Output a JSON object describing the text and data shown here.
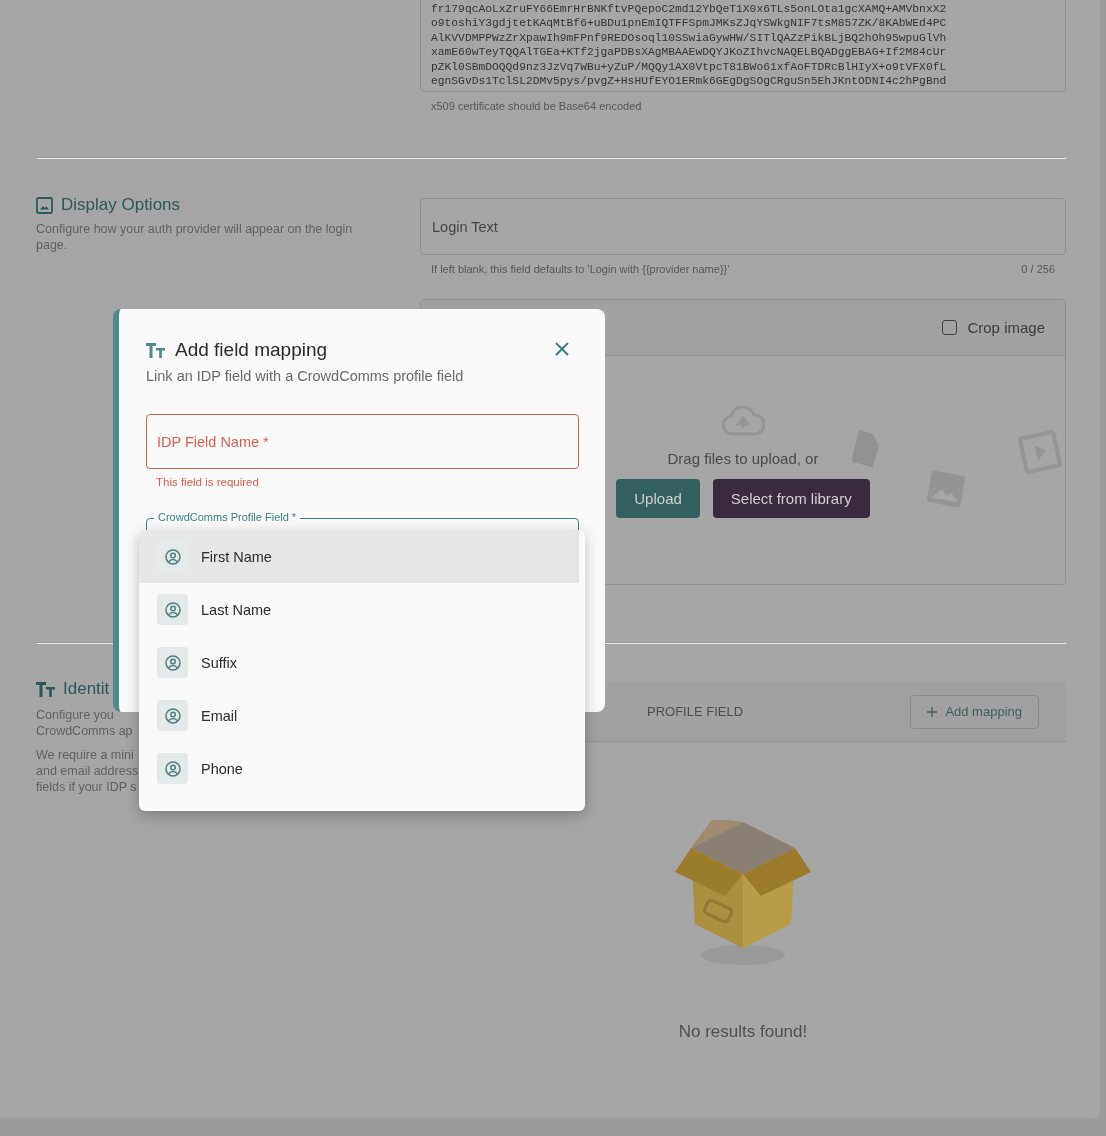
{
  "certificate": {
    "lines": [
      "fr179qcAoLxZruFY66EmrHrBNKftvPQepoC2md12YbQeT1X0x6TLs5onLOta1gcXAMQ+AMVbnxX2",
      "o9toshiY3gdjtetKAqMtBf6+uBDu1pnEmIQTFFSpmJMKsZJqYSWkgNIF7tsM857ZK/8KAbWEd4PC",
      "AlKVVDMPPWzZrXpawIh9mFPnf9REDOsoql10SSwiaGywHW/SITlQAZzPikBLjBQ2hOh95wpuGlVh",
      "xamE60wTeyTQQAlTGEa+KTf2jgaPDBsXAgMBAAEwDQYJKoZIhvcNAQELBQADggEBAG+If2M84cUr",
      "pZKl0SBmDOQQd9nz3JzVq7WBu+yZuP/MQQy1AX0VtpcT81BWo61xfAoFTDRcBlHIyX+o9tVFX0fL",
      "egnSGvDs1TclSL2DMv5pys/pvgZ+HsHUfEYO1ERmk6GEgDgSOgCRguSn5EhJKntODNI4c2hPgBnd"
    ],
    "hint": "x509 certificate should be Base64 encoded"
  },
  "display_options": {
    "title": "Display Options",
    "description": "Configure how your auth provider will appear on the login page.",
    "login_text": {
      "placeholder": "Login Text",
      "hint": "If left blank, this field defaults to 'Login with {{provider name}}'",
      "counter": "0 / 256"
    },
    "image_upload": {
      "crop_image": {
        "label": "Crop image",
        "checked": false
      },
      "prompt": "Drag files to upload, or",
      "buttons": [
        {
          "label": "Upload",
          "kind": "primary"
        },
        {
          "label": "Select from library",
          "kind": "secondary"
        }
      ]
    }
  },
  "identity": {
    "title": "Identit",
    "paragraphs": [
      [
        "Configure you",
        "CrowdComms ap"
      ],
      [
        "We require a mini",
        "and email address",
        "fields if your IDP s"
      ]
    ],
    "table": {
      "columns": [
        "PROFILE FIELD"
      ],
      "add_button": "Add mapping",
      "empty_message": "No results found!"
    }
  },
  "modal": {
    "title": "Add field mapping",
    "subtitle": "Link an IDP field with a CrowdComms profile field",
    "fields": [
      {
        "label": "IDP Field Name *",
        "error": "This field is required"
      },
      {
        "label": "CrowdComms Profile Field *",
        "focused": true
      }
    ],
    "dropdown": {
      "options": [
        {
          "label": "First Name",
          "selected": true
        },
        {
          "label": "Last Name",
          "selected": false
        },
        {
          "label": "Suffix",
          "selected": false
        },
        {
          "label": "Email",
          "selected": false
        },
        {
          "label": "Phone",
          "selected": false
        }
      ]
    }
  }
}
